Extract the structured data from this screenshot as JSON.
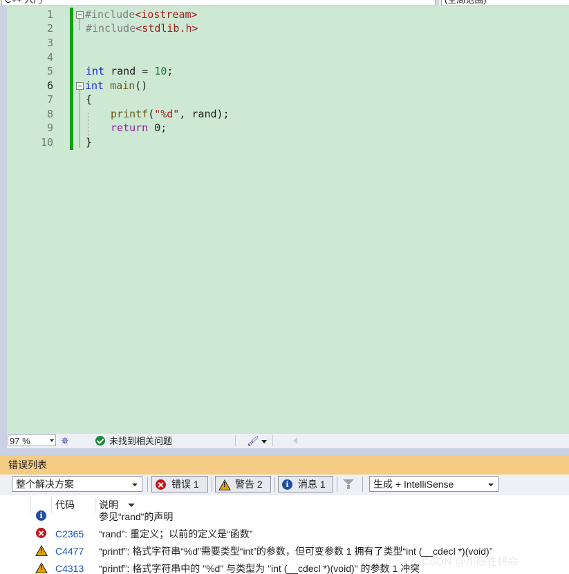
{
  "top": {
    "left_combo_text": "C++ 入门",
    "right_combo_text": "(全局范围)"
  },
  "editor": {
    "line_numbers": [
      "1",
      "2",
      "3",
      "4",
      "5",
      "6",
      "7",
      "8",
      "9",
      "10"
    ],
    "code": {
      "l1_pp": "#include",
      "l1_hdr": "<iostream>",
      "l2_pp": "#include",
      "l2_hdr": "<stdlib.h>",
      "l5_type": "int",
      "l5_rest": " rand = ",
      "l5_num": "10",
      "l5_end": ";",
      "l6_type": "int",
      "l6_fn": " main",
      "l6_rest": "()",
      "l7": "{",
      "l8_fn": "printf",
      "l8_open": "(",
      "l8_str": "\"%d\"",
      "l8_rest": ", rand);",
      "l9_kw": "return",
      "l9_rest": " 0;",
      "l10": "}"
    }
  },
  "status": {
    "zoom": "97 %",
    "message": "未找到相关问题",
    "colors": {
      "ok": "#1d8a3a"
    }
  },
  "error_list": {
    "title": "错误列表",
    "scope": "整个解决方案",
    "errors_label": "错误 1",
    "warnings_label": "警告 2",
    "messages_label": "消息 1",
    "build_filter": "生成 + IntelliSense",
    "col_code": "代码",
    "col_desc": "说明",
    "rows": [
      {
        "icon": "info-icon",
        "code": "",
        "desc": "参见“rand”的声明"
      },
      {
        "icon": "error-icon",
        "code": "C2365",
        "desc": "“rand”: 重定义；以前的定义是“函数”"
      },
      {
        "icon": "warning-icon",
        "code": "C4477",
        "desc": "“printf”: 格式字符串“%d”需要类型“int”的参数，但可变参数 1 拥有了类型“int (__cdecl *)(void)”"
      },
      {
        "icon": "warning-icon",
        "code": "C4313",
        "desc": "“printf”: 格式字符串中的 \"%d\" 与类型为 \"int (__cdecl *)(void)\" 的参数 1 冲突"
      }
    ]
  },
  "watermark": "CSDN @小陈在拼命"
}
